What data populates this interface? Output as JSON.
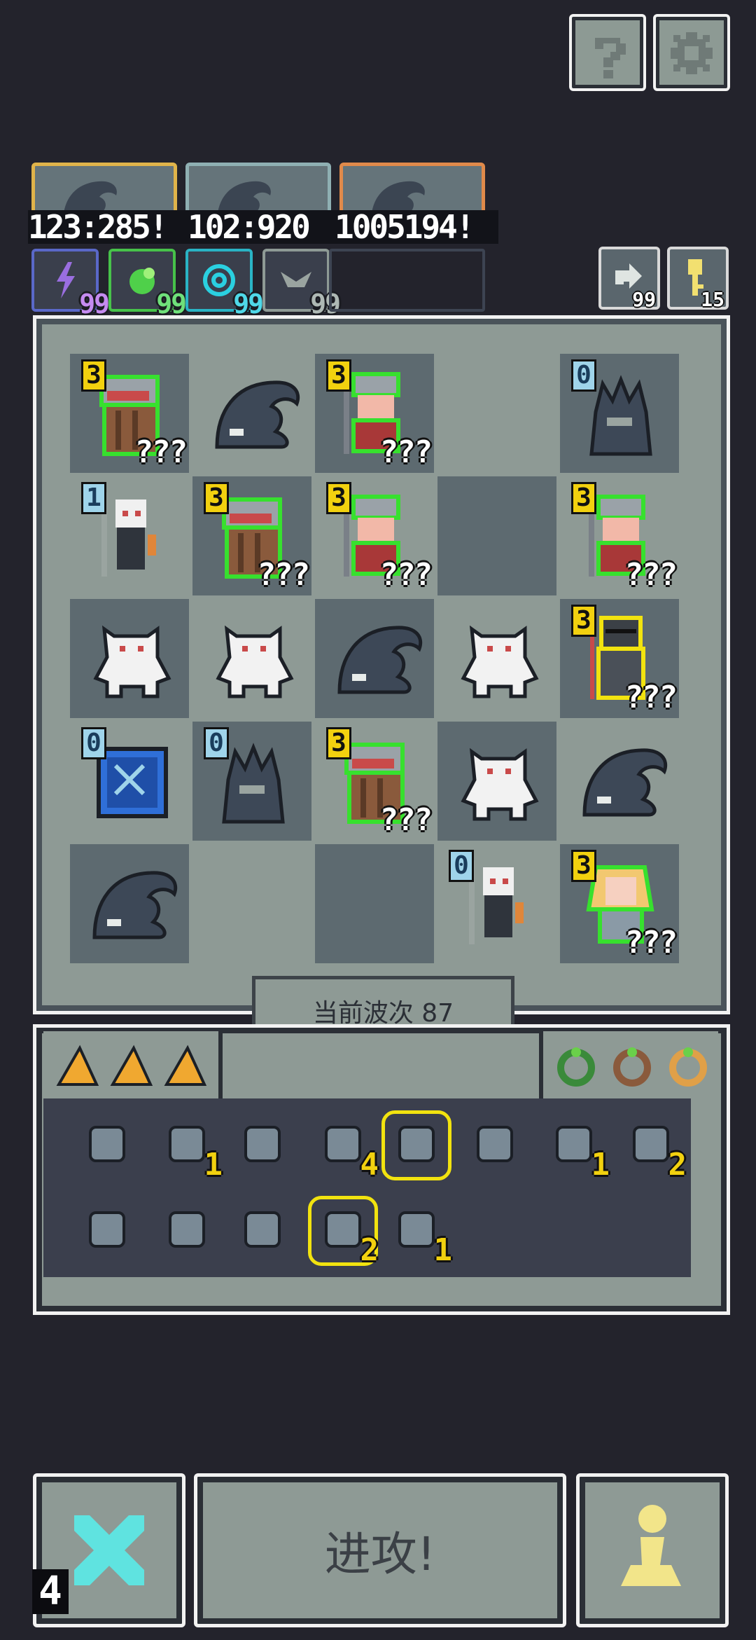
{
  "top_buttons": {
    "help_icon": "question-icon",
    "settings_icon": "gear-icon"
  },
  "resources": {
    "counters": [
      "123:285!",
      "102:920",
      "1005194!"
    ],
    "frame_colors": [
      "#e0b44a",
      "#8fb0b3",
      "#e08a4a"
    ]
  },
  "skills": [
    {
      "icon": "lightning-icon",
      "count": "99",
      "color": "#8a6cd8",
      "text_color": "#c58bf0"
    },
    {
      "icon": "green-blob-icon",
      "count": "99",
      "color": "#47c24a",
      "text_color": "#6fe07a"
    },
    {
      "icon": "swirl-icon",
      "count": "99",
      "color": "#2ab3c4",
      "text_color": "#4fd8e8"
    },
    {
      "icon": "bird-icon",
      "count": "99",
      "color": "#8e9a95",
      "text_color": "#aeb8b4"
    }
  ],
  "side_buttons": [
    {
      "icon": "refresh-arrow-icon",
      "count": "99"
    },
    {
      "icon": "key-icon",
      "count": "15"
    }
  ],
  "board": {
    "rows": [
      [
        {
          "unit": "dwarf-shield",
          "level": "3",
          "level_style": "gold",
          "unknown": "???",
          "outline": "#37e02e"
        },
        {
          "unit": "whale-slime"
        },
        {
          "unit": "knight-woman",
          "level": "3",
          "level_style": "gold",
          "unknown": "???",
          "outline": "#37e02e"
        },
        {
          "unit": ""
        },
        {
          "unit": "shadow-fiend",
          "level": "0",
          "level_style": "blue"
        }
      ],
      [
        {
          "unit": "bone-shaman",
          "level": "1",
          "level_style": "blue"
        },
        {
          "unit": "dwarf-shield",
          "level": "3",
          "level_style": "gold",
          "unknown": "???",
          "outline": "#37e02e"
        },
        {
          "unit": "knight-woman",
          "level": "3",
          "level_style": "gold",
          "unknown": "???",
          "outline": "#37e02e"
        },
        {
          "unit": ""
        },
        {
          "unit": "knight-woman",
          "level": "3",
          "level_style": "gold",
          "unknown": "???",
          "outline": "#37e02e"
        }
      ],
      [
        {
          "unit": "white-yeti"
        },
        {
          "unit": "white-yeti"
        },
        {
          "unit": "whale-slime"
        },
        {
          "unit": "white-yeti"
        },
        {
          "unit": "dark-knight",
          "level": "3",
          "level_style": "gold",
          "unknown": "???",
          "outline": "#f2e30f"
        }
      ],
      [
        {
          "unit": "blue-portal",
          "level": "0",
          "level_style": "blue"
        },
        {
          "unit": "shadow-fiend",
          "level": "0",
          "level_style": "blue"
        },
        {
          "unit": "dwarf-shield",
          "level": "3",
          "level_style": "gold",
          "unknown": "???",
          "outline": "#37e02e"
        },
        {
          "unit": "white-yeti"
        },
        {
          "unit": "whale-slime"
        }
      ],
      [
        {
          "unit": "whale-slime"
        },
        {
          "unit": ""
        },
        {
          "unit": ""
        },
        {
          "unit": "bone-shaman",
          "level": "0",
          "level_style": "blue"
        },
        {
          "unit": "blonde-girl",
          "level": "3",
          "level_style": "gold",
          "unknown": "???",
          "outline": "#37e02e"
        }
      ]
    ]
  },
  "wave_label": "当前波次 87",
  "tabs": {
    "left": [
      "crystal-shard-icon",
      "crystal-shard-icon",
      "crystal-shard-icon"
    ],
    "right": [
      "green-ring-icon",
      "brown-ring-icon",
      "purple-ring-icon"
    ]
  },
  "inventory": [
    {
      "icon": "green-flame-icon",
      "count": ""
    },
    {
      "icon": "bone-icon",
      "count": "1"
    },
    {
      "icon": "shield-icon",
      "count": ""
    },
    {
      "icon": "scroll-map-icon",
      "count": "4"
    },
    {
      "icon": "crystal-crown-icon",
      "count": "",
      "highlight": true
    },
    {
      "icon": "trident-crown-icon",
      "count": ""
    },
    {
      "icon": "purple-orb-icon",
      "count": "1"
    },
    {
      "icon": "axe-icon",
      "count": "2"
    },
    {
      "icon": "grass-block-icon",
      "count": ""
    },
    {
      "icon": "pink-arrow-icon",
      "count": ""
    },
    {
      "icon": "green-arrow-icon",
      "count": ""
    },
    {
      "icon": "potion-jar-icon",
      "count": "2",
      "highlight": true
    },
    {
      "icon": "gold-ring-icon",
      "count": "1"
    }
  ],
  "bottom": {
    "left_count": "4",
    "attack_label": "进攻!",
    "left_icon": "crossed-swords-icon",
    "right_icon": "pawn-icon"
  }
}
